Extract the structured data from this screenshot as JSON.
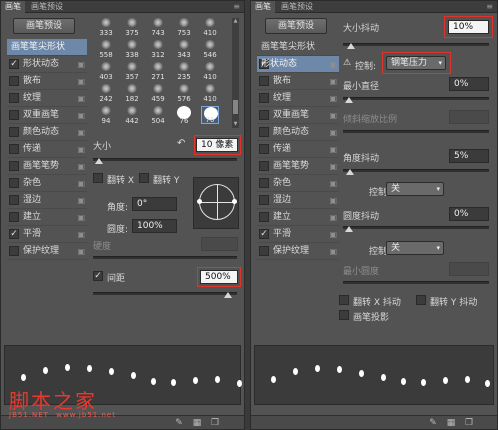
{
  "left_panel": {
    "tabs": [
      "画笔",
      "画笔预设"
    ],
    "presets_button": "画笔预设",
    "list": [
      {
        "label": "画笔笔尖形状",
        "checked": null,
        "header": true,
        "lock": false
      },
      {
        "label": "形状动态",
        "checked": true,
        "header": false,
        "lock": true
      },
      {
        "label": "散布",
        "checked": false,
        "header": false,
        "lock": true
      },
      {
        "label": "纹理",
        "checked": false,
        "header": false,
        "lock": true
      },
      {
        "label": "双重画笔",
        "checked": false,
        "header": false,
        "lock": true
      },
      {
        "label": "颜色动态",
        "checked": false,
        "header": false,
        "lock": true
      },
      {
        "label": "传递",
        "checked": false,
        "header": false,
        "lock": true
      },
      {
        "label": "画笔笔势",
        "checked": false,
        "header": false,
        "lock": true
      },
      {
        "label": "杂色",
        "checked": false,
        "header": false,
        "lock": true
      },
      {
        "label": "湿边",
        "checked": false,
        "header": false,
        "lock": true
      },
      {
        "label": "建立",
        "checked": false,
        "header": false,
        "lock": true
      },
      {
        "label": "平滑",
        "checked": true,
        "header": false,
        "lock": true
      },
      {
        "label": "保护纹理",
        "checked": false,
        "header": false,
        "lock": true
      }
    ],
    "brush_grid": [
      [
        "333",
        "375",
        "743",
        "753",
        "410"
      ],
      [
        "558",
        "338",
        "312",
        "343",
        "546"
      ],
      [
        "403",
        "357",
        "271",
        "235",
        "410"
      ],
      [
        "242",
        "182",
        "459",
        "576",
        "410"
      ],
      [
        "94",
        "442",
        "504",
        "76",
        "76"
      ]
    ],
    "size_label": "大小",
    "size_value": "10 像素",
    "flip_x": "翻转 X",
    "flip_y": "翻转 Y",
    "angle_label": "角度:",
    "angle_value": "0°",
    "roundness_label": "圆度:",
    "roundness_value": "100%",
    "hardness_label": "硬度",
    "spacing_label": "间距",
    "spacing_checked": true,
    "spacing_value": "500%",
    "watermark": "脚本之家",
    "watermark_url": "JB51.NET",
    "watermark_site": "www.jb51.net"
  },
  "right_panel": {
    "tabs": [
      "画笔",
      "画笔预设"
    ],
    "presets_button": "画笔预设",
    "list": [
      {
        "label": "画笔笔尖形状",
        "checked": null,
        "header": false,
        "lock": false
      },
      {
        "label": "形状动态",
        "checked": true,
        "header": true,
        "lock": true
      },
      {
        "label": "散布",
        "checked": false,
        "header": false,
        "lock": true
      },
      {
        "label": "纹理",
        "checked": false,
        "header": false,
        "lock": true
      },
      {
        "label": "双重画笔",
        "checked": false,
        "header": false,
        "lock": true
      },
      {
        "label": "颜色动态",
        "checked": false,
        "header": false,
        "lock": true
      },
      {
        "label": "传递",
        "checked": false,
        "header": false,
        "lock": true
      },
      {
        "label": "画笔笔势",
        "checked": false,
        "header": false,
        "lock": true
      },
      {
        "label": "杂色",
        "checked": false,
        "header": false,
        "lock": true
      },
      {
        "label": "湿边",
        "checked": false,
        "header": false,
        "lock": true
      },
      {
        "label": "建立",
        "checked": false,
        "header": false,
        "lock": true
      },
      {
        "label": "平滑",
        "checked": true,
        "header": false,
        "lock": true
      },
      {
        "label": "保护纹理",
        "checked": false,
        "header": false,
        "lock": true
      }
    ],
    "size_jitter_label": "大小抖动",
    "size_jitter_value": "10%",
    "control_label": "控制:",
    "control_value": "钢笔压力",
    "min_diameter_label": "最小直径",
    "min_diameter_value": "0%",
    "tilt_scale_label": "倾斜缩放比例",
    "angle_jitter_label": "角度抖动",
    "angle_jitter_value": "5%",
    "angle_control_label": "控制:",
    "angle_control_value": "关",
    "roundness_jitter_label": "圆度抖动",
    "roundness_jitter_value": "0%",
    "roundness_control_label": "控制:",
    "roundness_control_value": "关",
    "min_roundness_label": "最小圆度",
    "flip_x_jitter": "翻转 X 抖动",
    "flip_y_jitter": "翻转 Y 抖动",
    "brush_projection": "画笔投影"
  }
}
